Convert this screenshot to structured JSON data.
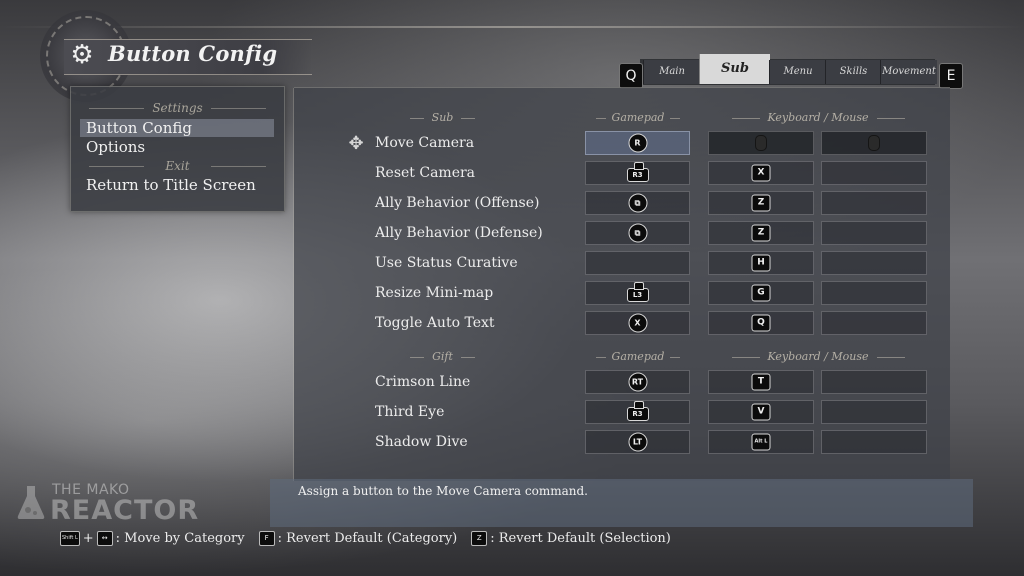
{
  "header": {
    "title": "Button Config",
    "icon": "gear-icon"
  },
  "menu": {
    "sections": [
      {
        "heading": "Settings",
        "items": [
          {
            "label": "Button Config",
            "selected": true
          },
          {
            "label": "Options",
            "selected": false
          }
        ]
      },
      {
        "heading": "Exit",
        "items": [
          {
            "label": "Return to Title Screen",
            "selected": false
          }
        ]
      }
    ]
  },
  "tabs": {
    "prev_key": "Q",
    "next_key": "E",
    "items": [
      {
        "label": "Main",
        "active": false
      },
      {
        "label": "Sub",
        "active": true
      },
      {
        "label": "Menu",
        "active": false
      },
      {
        "label": "Skills",
        "active": false
      },
      {
        "label": "Movement",
        "active": false
      }
    ]
  },
  "sections": [
    {
      "category": "Sub",
      "gamepad_header": "Gamepad",
      "keyboard_header": "Keyboard / Mouse",
      "rows": [
        {
          "label": "Move Camera",
          "gamepad": "R",
          "gamepad_type": "stick-round",
          "kb1": "",
          "kb1_type": "mouse",
          "kb2": "",
          "kb2_type": "mouse",
          "selected": true
        },
        {
          "label": "Reset Camera",
          "gamepad": "R3",
          "gamepad_type": "stick",
          "kb1": "X",
          "kb1_type": "key",
          "kb2": "",
          "kb2_type": "empty"
        },
        {
          "label": "Ally Behavior (Offense)",
          "gamepad": "⧉",
          "gamepad_type": "button",
          "kb1": "Z",
          "kb1_type": "key",
          "kb2": "",
          "kb2_type": "empty"
        },
        {
          "label": "Ally Behavior (Defense)",
          "gamepad": "⧉",
          "gamepad_type": "button",
          "kb1": "Z",
          "kb1_type": "key",
          "kb2": "",
          "kb2_type": "empty"
        },
        {
          "label": "Use Status Curative",
          "gamepad": "",
          "gamepad_type": "empty",
          "kb1": "H",
          "kb1_type": "key",
          "kb2": "",
          "kb2_type": "empty"
        },
        {
          "label": "Resize Mini-map",
          "gamepad": "L3",
          "gamepad_type": "stick",
          "kb1": "G",
          "kb1_type": "key",
          "kb2": "",
          "kb2_type": "empty"
        },
        {
          "label": "Toggle Auto Text",
          "gamepad": "X",
          "gamepad_type": "button",
          "kb1": "Q",
          "kb1_type": "key",
          "kb2": "",
          "kb2_type": "empty"
        }
      ]
    },
    {
      "category": "Gift",
      "gamepad_header": "Gamepad",
      "keyboard_header": "Keyboard / Mouse",
      "rows": [
        {
          "label": "Crimson Line",
          "gamepad": "RT",
          "gamepad_type": "button",
          "kb1": "T",
          "kb1_type": "key",
          "kb2": "",
          "kb2_type": "empty"
        },
        {
          "label": "Third Eye",
          "gamepad": "R3",
          "gamepad_type": "stick",
          "kb1": "V",
          "kb1_type": "key",
          "kb2": "",
          "kb2_type": "empty"
        },
        {
          "label": "Shadow Dive",
          "gamepad": "LT",
          "gamepad_type": "button",
          "kb1": "Alt L",
          "kb1_type": "key",
          "kb2": "",
          "kb2_type": "empty"
        }
      ]
    }
  ],
  "description": "Assign a button to the Move Camera command.",
  "watermark": {
    "line1": "THE MAKO",
    "line2": "REACTOR"
  },
  "footer": [
    {
      "keys": [
        "Shift L",
        "+",
        "↔"
      ],
      "label": ": Move by Category"
    },
    {
      "keys": [
        "F"
      ],
      "label": ": Revert Default (Category)"
    },
    {
      "keys": [
        "Z"
      ],
      "label": ": Revert Default (Selection)"
    }
  ]
}
